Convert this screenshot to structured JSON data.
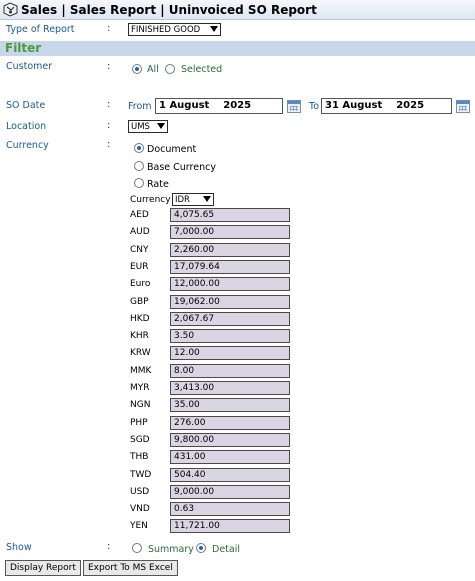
{
  "header": {
    "title": "Sales | Sales Report | Uninvoiced SO Report"
  },
  "type_of_report": {
    "label": "Type of Report",
    "value": "FINISHED GOOD"
  },
  "filter": {
    "heading": "Filter"
  },
  "customer": {
    "label": "Customer",
    "options": [
      "All",
      "Selected"
    ],
    "selected": "All"
  },
  "so_date": {
    "label": "SO Date",
    "from_label": "From",
    "from_value": "1 August    2025",
    "to_label": "To",
    "to_value": "31 August    2025"
  },
  "location": {
    "label": "Location",
    "value": "UMS"
  },
  "currency": {
    "label": "Currency",
    "options": [
      "Document",
      "Base Currency",
      "Rate"
    ],
    "selected": "Document",
    "select_label": "Currency",
    "select_value": "IDR"
  },
  "rates": [
    {
      "code": "AED",
      "value": "4,075.65"
    },
    {
      "code": "AUD",
      "value": "7,000.00"
    },
    {
      "code": "CNY",
      "value": "2,260.00"
    },
    {
      "code": "EUR",
      "value": "17,079.64"
    },
    {
      "code": "Euro",
      "value": "12,000.00"
    },
    {
      "code": "GBP",
      "value": "19,062.00"
    },
    {
      "code": "HKD",
      "value": "2,067.67"
    },
    {
      "code": "KHR",
      "value": "3.50"
    },
    {
      "code": "KRW",
      "value": "12.00"
    },
    {
      "code": "MMK",
      "value": "8.00"
    },
    {
      "code": "MYR",
      "value": "3,413.00"
    },
    {
      "code": "NGN",
      "value": "35.00"
    },
    {
      "code": "PHP",
      "value": "276.00"
    },
    {
      "code": "SGD",
      "value": "9,800.00"
    },
    {
      "code": "THB",
      "value": "431.00"
    },
    {
      "code": "TWD",
      "value": "504.40"
    },
    {
      "code": "USD",
      "value": "9,000.00"
    },
    {
      "code": "VND",
      "value": "0.63"
    },
    {
      "code": "YEN",
      "value": "11,721.00"
    }
  ],
  "show": {
    "label": "Show",
    "options": [
      "Summary",
      "Detail"
    ],
    "selected": "Detail"
  },
  "buttons": {
    "display": "Display Report",
    "export": "Export To MS Excel"
  },
  "colors": {
    "filter_band": "#c8d6e9",
    "filter_text": "#4d9a3e",
    "rate_box": "#d9d5e3"
  },
  "icons": {
    "logo": "app-logo-icon",
    "calendar": "calendar-icon"
  }
}
